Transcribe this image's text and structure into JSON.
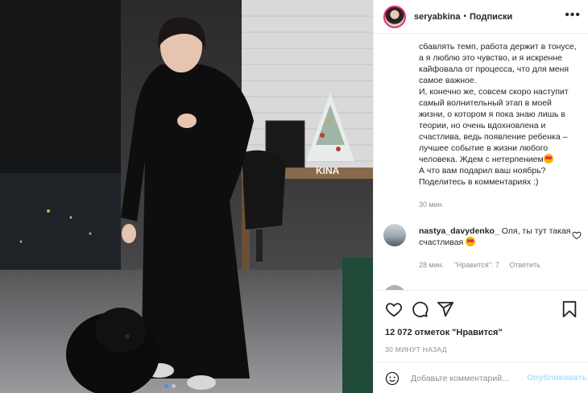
{
  "post": {
    "author": "seryabkina",
    "separator": "•",
    "follow_label": "Подписки",
    "more_label": "•••"
  },
  "photo": {
    "watermark": "KINA",
    "carousel_dots": 2,
    "active_dot": 0
  },
  "caption": {
    "lines": [
      "сбавлять темп, работа держит в тонусе,",
      "а я люблю это чувство, и я искренне",
      "кайфовала от процесса, что для меня",
      "самое важное.",
      "И, конечно же, совсем скоро наступит",
      "самый волнительный этап в моей",
      "жизни, о котором я пока знаю лишь в",
      "теории, но очень вдохновлена и",
      "счастлива, ведь появление ребенка –",
      "лучшее событие в жизни любого",
      "человека. Ждем с нетерпением",
      "А что вам подарил ваш ноябрь?",
      "Поделитесь в комментариях :)"
    ],
    "time": "30 мин."
  },
  "comments": [
    {
      "user": "nastya_davydenko_",
      "text": "Оля, ты тут такая счастливая",
      "time": "28 мин.",
      "likes": "\"Нравится\": 7",
      "reply": "Ответить"
    }
  ],
  "footer": {
    "likes": "12 072 отметок \"Нравится\"",
    "ago": "30 МИНУТ НАЗАД",
    "comment_placeholder": "Добавьте комментарий...",
    "post_label": "Опубликовать"
  },
  "icons": {
    "like": "heart-icon",
    "comment": "comment-icon",
    "share": "share-icon",
    "save": "bookmark-icon",
    "emoji": "emoji-icon",
    "comment_like": "heart-outline-icon"
  },
  "colors": {
    "post_button": "#b2dffc",
    "active_dot": "#3897f0",
    "text": "#262626",
    "muted": "#8e8e8e"
  }
}
